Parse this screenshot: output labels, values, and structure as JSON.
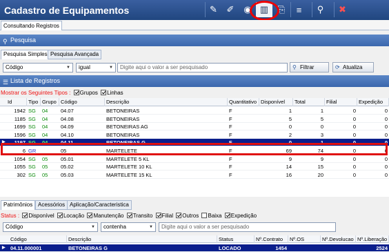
{
  "app": {
    "title": "Cadastro de Equipamentos"
  },
  "toolbar": {
    "buttons": [
      {
        "name": "pencil-icon",
        "glyph": "✎"
      },
      {
        "name": "edit-icon",
        "glyph": "✐"
      },
      {
        "name": "view-icon",
        "glyph": "👁"
      },
      {
        "name": "trash-icon",
        "glyph": "🗑"
      },
      {
        "name": "copy-icon",
        "glyph": "⎘"
      },
      {
        "name": "menu-icon",
        "glyph": "≡"
      },
      {
        "name": "search-icon",
        "glyph": "🔍"
      },
      {
        "name": "close-icon",
        "glyph": "✖"
      }
    ]
  },
  "tab_main": "Consultando Registros",
  "pesquisa": {
    "title": "Pesquisa",
    "tabs": [
      "Pesquisa Simples",
      "Pesquisa Avançada"
    ],
    "field": "Código",
    "operator": "igual",
    "placeholder": "Digite aqui o valor a ser pesquisado",
    "filter_label": "Filtrar",
    "refresh_label": "Atualiza"
  },
  "lista": {
    "title": "Lista de Registros",
    "types_label": "Mostrar os Seguintes Tipos :",
    "grupos": "Grupos",
    "linhas": "Linhas",
    "columns": [
      "Id",
      "Tipo",
      "Grupo",
      "Código",
      "Descrição",
      "Quantitativo",
      "Disponível",
      "Total",
      "Filial",
      "Expedição"
    ],
    "rows": [
      {
        "id": "1942",
        "tipo": "SG",
        "grupo": "04",
        "codigo": "04.07",
        "descricao": "BETONEIRAS",
        "quant": "F",
        "disp": "1",
        "total": "1",
        "filial": "0",
        "exped": "0"
      },
      {
        "id": "1185",
        "tipo": "SG",
        "grupo": "04",
        "codigo": "04.08",
        "descricao": "BETONEIRAS",
        "quant": "F",
        "disp": "5",
        "total": "5",
        "filial": "0",
        "exped": "0"
      },
      {
        "id": "1699",
        "tipo": "SG",
        "grupo": "04",
        "codigo": "04.09",
        "descricao": "BETONEIRAS AG",
        "quant": "F",
        "disp": "0",
        "total": "0",
        "filial": "0",
        "exped": "0"
      },
      {
        "id": "1596",
        "tipo": "SG",
        "grupo": "04",
        "codigo": "04.10",
        "descricao": "BETONEIRAS",
        "quant": "F",
        "disp": "2",
        "total": "3",
        "filial": "0",
        "exped": "0"
      },
      {
        "id": "1197",
        "tipo": "SG",
        "grupo": "04",
        "codigo": "04.11",
        "descricao": "BETONEIRAS G",
        "quant": "F",
        "disp": "0",
        "total": "1",
        "filial": "0",
        "exped": "0"
      },
      {
        "id": "6",
        "tipo": "GR",
        "grupo": "",
        "codigo": "05",
        "descricao": "MARTELETE",
        "quant": "F",
        "disp": "69",
        "total": "74",
        "filial": "0",
        "exped": "0"
      },
      {
        "id": "1054",
        "tipo": "SG",
        "grupo": "05",
        "codigo": "05.01",
        "descricao": "MARTELETE 5 KL",
        "quant": "F",
        "disp": "9",
        "total": "9",
        "filial": "0",
        "exped": "0"
      },
      {
        "id": "1055",
        "tipo": "SG",
        "grupo": "05",
        "codigo": "05.02",
        "descricao": "MARTELETE 10 KL",
        "quant": "F",
        "disp": "14",
        "total": "15",
        "filial": "0",
        "exped": "0"
      },
      {
        "id": "302",
        "tipo": "SG",
        "grupo": "05",
        "codigo": "05.03",
        "descricao": "MARTELETE 15 KL",
        "quant": "F",
        "disp": "16",
        "total": "20",
        "filial": "0",
        "exped": "0"
      }
    ]
  },
  "bottom": {
    "tabs": [
      "Patrimônios",
      "Acessórios",
      "Aplicação/Caracteristica"
    ],
    "status_label": "Status :",
    "statuses": [
      "Disponível",
      "Locação",
      "Manutenção",
      "Transito",
      "Filial",
      "Outros",
      "Baixa",
      "Expedição"
    ],
    "field": "Código",
    "operator": "contenha",
    "placeholder": "Digite aqui o valor a ser pesquisado",
    "columns": [
      "Código",
      "Descrição",
      "Status",
      "Nº.Contrato",
      "Nº.OS",
      "Nº.Devolucao",
      "Nº.Liberação"
    ],
    "row": {
      "codigo": "04.11.000001",
      "descricao": "BETONEIRAS G",
      "status": "LOCADO",
      "contrato": "1454",
      "os": "",
      "devolucao": "",
      "liberacao": "2524"
    }
  },
  "colors": {
    "title_bg": "#20467f",
    "section_bg": "#3b67ad",
    "selected_row": "#0a1e8c",
    "highlight": "#e01010"
  }
}
